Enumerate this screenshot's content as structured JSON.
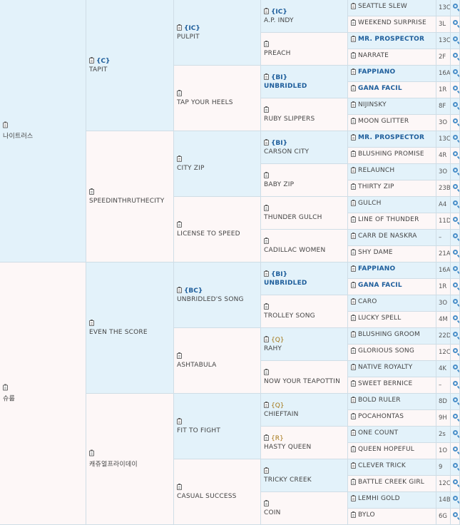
{
  "gen1": [
    {
      "tag": "",
      "name": "나이트러스"
    },
    {
      "tag": "",
      "name": "슈룹"
    }
  ],
  "gen2": [
    {
      "tag": "{C}",
      "name": "TAPIT"
    },
    {
      "tag": "",
      "name": "SPEEDINTHRUTHECITY"
    },
    {
      "tag": "",
      "name": "EVEN THE SCORE"
    },
    {
      "tag": "",
      "name": "캐쥬얼프라이데이"
    }
  ],
  "gen3": [
    {
      "tag": "{IC}",
      "name": "PULPIT"
    },
    {
      "tag": "",
      "name": "TAP YOUR HEELS"
    },
    {
      "tag": "",
      "name": "CITY ZIP"
    },
    {
      "tag": "",
      "name": "LICENSE TO SPEED"
    },
    {
      "tag": "{BC}",
      "name": "UNBRIDLED'S SONG"
    },
    {
      "tag": "",
      "name": "ASHTABULA"
    },
    {
      "tag": "",
      "name": "FIT TO FIGHT"
    },
    {
      "tag": "",
      "name": "CASUAL SUCCESS"
    }
  ],
  "gen4": [
    {
      "tag": "{IC}",
      "name": "A.P. INDY"
    },
    {
      "tag": "",
      "name": "PREACH"
    },
    {
      "tag": "{BI}",
      "name": "UNBRIDLED"
    },
    {
      "tag": "",
      "name": "RUBY SLIPPERS"
    },
    {
      "tag": "{BI}",
      "name": "CARSON CITY"
    },
    {
      "tag": "",
      "name": "BABY ZIP"
    },
    {
      "tag": "",
      "name": "THUNDER GULCH"
    },
    {
      "tag": "",
      "name": "CADILLAC WOMEN"
    },
    {
      "tag": "{BI}",
      "name": "UNBRIDLED"
    },
    {
      "tag": "",
      "name": "TROLLEY SONG"
    },
    {
      "tag": "{Q}",
      "name": "RAHY"
    },
    {
      "tag": "",
      "name": "NOW YOUR TEAPOTTIN"
    },
    {
      "tag": "{Q}",
      "name": "CHIEFTAIN"
    },
    {
      "tag": "{R}",
      "name": "HASTY QUEEN"
    },
    {
      "tag": "",
      "name": "TRICKY CREEK"
    },
    {
      "tag": "",
      "name": "COIN"
    }
  ],
  "gen5": [
    {
      "name": "SEATTLE SLEW",
      "code": "13C"
    },
    {
      "name": "WEEKEND SURPRISE",
      "code": "3L"
    },
    {
      "name": "MR. PROSPECTOR",
      "code": "13C"
    },
    {
      "name": "NARRATE",
      "code": "2F"
    },
    {
      "name": "FAPPIANO",
      "code": "16A"
    },
    {
      "name": "GANA FACIL",
      "code": "1R"
    },
    {
      "name": "NIJINSKY",
      "code": "8F"
    },
    {
      "name": "MOON GLITTER",
      "code": "3O"
    },
    {
      "name": "MR. PROSPECTOR",
      "code": "13C"
    },
    {
      "name": "BLUSHING PROMISE",
      "code": "4R"
    },
    {
      "name": "RELAUNCH",
      "code": "3O"
    },
    {
      "name": "THIRTY ZIP",
      "code": "23B"
    },
    {
      "name": "GULCH",
      "code": "A4"
    },
    {
      "name": "LINE OF THUNDER",
      "code": "11D"
    },
    {
      "name": "CARR DE NASKRA",
      "code": "–"
    },
    {
      "name": "SHY DAME",
      "code": "21A"
    },
    {
      "name": "FAPPIANO",
      "code": "16A"
    },
    {
      "name": "GANA FACIL",
      "code": "1R"
    },
    {
      "name": "CARO",
      "code": "3O"
    },
    {
      "name": "LUCKY SPELL",
      "code": "4M"
    },
    {
      "name": "BLUSHING GROOM",
      "code": "22D"
    },
    {
      "name": "GLORIOUS SONG",
      "code": "12C"
    },
    {
      "name": "NATIVE ROYALTY",
      "code": "4K"
    },
    {
      "name": "SWEET BERNICE",
      "code": "–"
    },
    {
      "name": "BOLD RULER",
      "code": "8D"
    },
    {
      "name": "POCAHONTAS",
      "code": "9H"
    },
    {
      "name": "ONE COUNT",
      "code": "2s"
    },
    {
      "name": "QUEEN HOPEFUL",
      "code": "1O"
    },
    {
      "name": "CLEVER TRICK",
      "code": "9"
    },
    {
      "name": "BATTLE CREEK GIRL",
      "code": "12C"
    },
    {
      "name": "LEMHI GOLD",
      "code": "14B"
    },
    {
      "name": "BYLO",
      "code": "6G"
    }
  ]
}
